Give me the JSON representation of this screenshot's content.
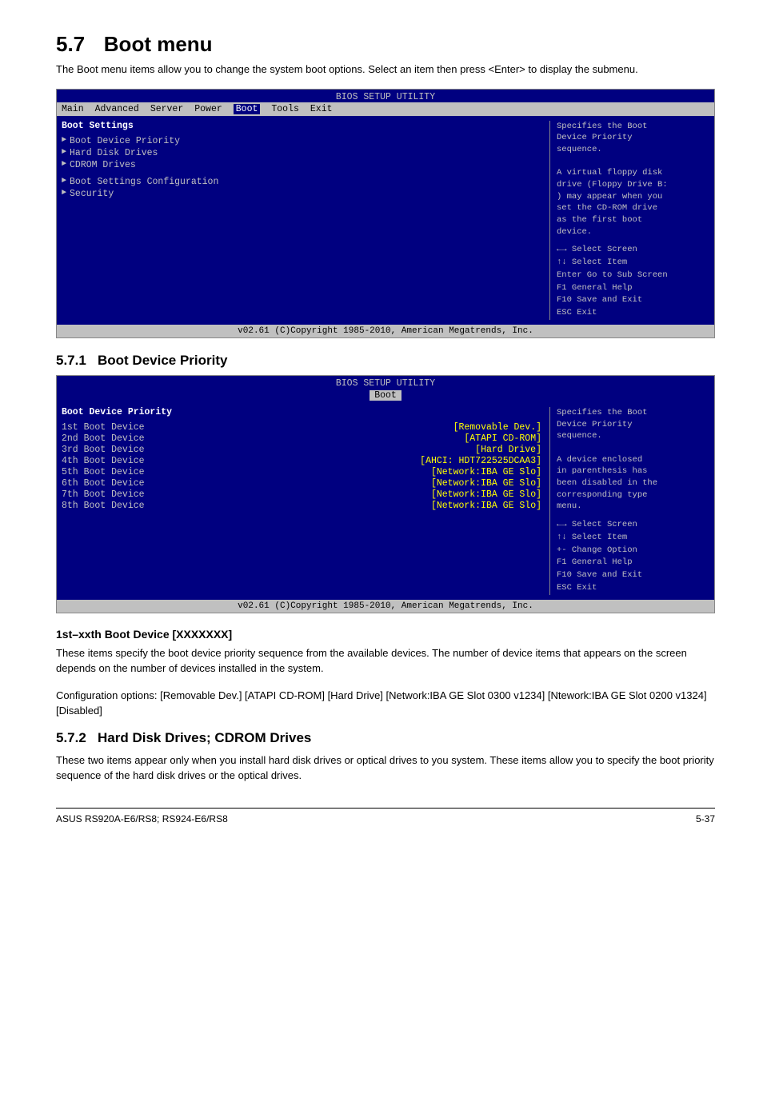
{
  "page": {
    "section_number": "5.7",
    "section_title": "Boot menu",
    "section_desc": "The Boot menu items allow you to change the system boot options. Select an item then press <Enter> to display the submenu.",
    "bios1": {
      "title": "BIOS SETUP UTILITY",
      "menu": [
        "Main",
        "Advanced",
        "Server",
        "Power",
        "Boot",
        "Tools",
        "Exit"
      ],
      "active_menu": "Boot",
      "section_header": "Boot Settings",
      "items": [
        {
          "arrow": true,
          "label": "Boot Device Priority"
        },
        {
          "arrow": true,
          "label": "Hard Disk Drives"
        },
        {
          "arrow": true,
          "label": "CDROM Drives"
        },
        {
          "arrow": true,
          "label": "Boot Settings Configuration"
        },
        {
          "arrow": true,
          "label": "Security"
        }
      ],
      "help_text": "Specifies the Boot\nDevice Priority\nsequence.\n\nA virtual floppy disk\ndrive (Floppy Drive B:\n) may appear when you\nset the CD-ROM drive\nas the first boot\ndevice.",
      "help_keys": "←→   Select Screen\n↑↓   Select Item\nEnter Go to Sub Screen\nF1   General Help\nF10  Save and Exit\nESC  Exit",
      "footer": "v02.61  (C)Copyright 1985-2010, American Megatrends, Inc."
    },
    "sub571": {
      "number": "5.7.1",
      "title": "Boot Device Priority",
      "bios": {
        "title": "BIOS SETUP UTILITY",
        "active_menu": "Boot",
        "section_header": "Boot Device Priority",
        "items": [
          {
            "label": "1st Boot Device",
            "value": "[Removable Dev.]"
          },
          {
            "label": "2nd Boot Device",
            "value": "[ATAPI CD-ROM]"
          },
          {
            "label": "3rd Boot Device",
            "value": "[Hard Drive]"
          },
          {
            "label": "4th Boot Device",
            "value": "[AHCI: HDT722525DCAA3]"
          },
          {
            "label": "5th Boot Device",
            "value": "[Network:IBA GE Slo]"
          },
          {
            "label": "6th Boot Device",
            "value": "[Network:IBA GE Slo]"
          },
          {
            "label": "7th Boot Device",
            "value": "[Network:IBA GE Slo]"
          },
          {
            "label": "8th Boot Device",
            "value": "[Network:IBA GE Slo]"
          }
        ],
        "help_text": "Specifies the Boot\nDevice Priority\nsequence.\n\nA device enclosed\nin parenthesis has\nbeen disabled in the\ncorresponding type\nmenu.",
        "help_keys": "←→  Select Screen\n↑↓  Select Item\n+-  Change Option\nF1  General Help\nF10 Save and Exit\nESC Exit",
        "footer": "v02.61  (C)Copyright 1985-2010, American Megatrends, Inc."
      }
    },
    "boot_device_section": {
      "title": "1st–xxth Boot Device [XXXXXXX]",
      "desc1": "These items specify the boot device priority sequence from the available devices. The number of device items that appears on the screen depends on the number of devices installed in the system.",
      "desc2": "Configuration options: [Removable Dev.] [ATAPI CD-ROM] [Hard Drive] [Network:IBA GE Slot 0300 v1234] [Ntework:IBA GE Slot 0200 v1324] [Disabled]"
    },
    "sub572": {
      "number": "5.7.2",
      "title": "Hard Disk Drives; CDROM Drives",
      "desc": "These two items appear only when you install hard disk drives or optical drives to you system. These items allow you to specify the boot priority sequence of the hard disk drives or the optical drives."
    },
    "footer": {
      "left": "ASUS RS920A-E6/RS8; RS924-E6/RS8",
      "right": "5-37"
    }
  }
}
